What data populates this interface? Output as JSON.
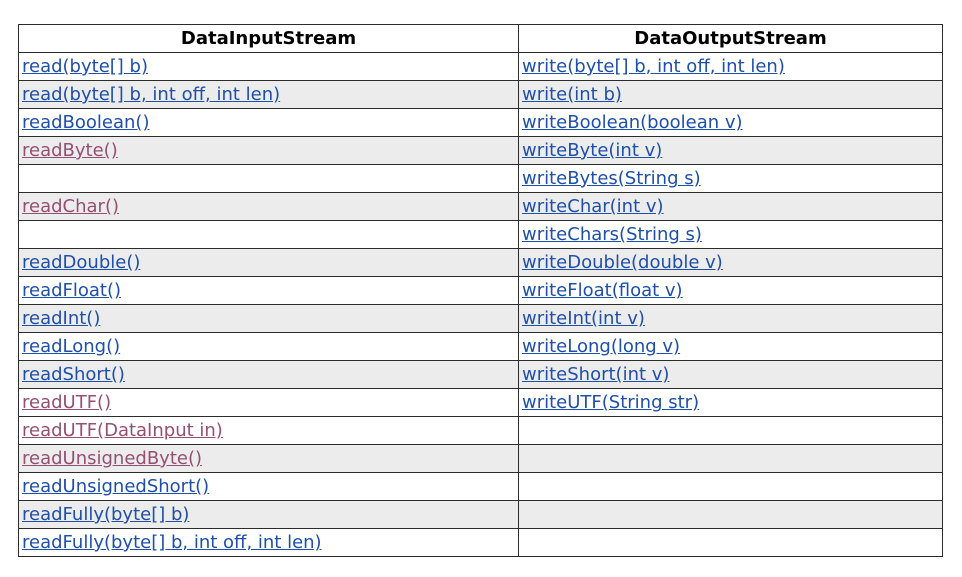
{
  "headers": {
    "left": "DataInputStream",
    "right": "DataOutputStream"
  },
  "colors": {
    "link": "#1f4fa8",
    "visited": "#954f72",
    "shade": "#ececec",
    "border": "#2b2b2b"
  },
  "rows": [
    {
      "input": "read(byte[] b)",
      "input_visited": false,
      "output": "write(byte[] b, int off, int len)",
      "output_visited": false,
      "shaded": false
    },
    {
      "input": "read(byte[] b, int off, int len)",
      "input_visited": false,
      "output": "write(int b)",
      "output_visited": false,
      "shaded": true
    },
    {
      "input": "readBoolean()",
      "input_visited": false,
      "output": "writeBoolean(boolean v)",
      "output_visited": false,
      "shaded": false
    },
    {
      "input": "readByte()",
      "input_visited": true,
      "output": "writeByte(int v)",
      "output_visited": false,
      "shaded": true
    },
    {
      "input": "",
      "input_visited": false,
      "output": "writeBytes(String s)",
      "output_visited": false,
      "shaded": false
    },
    {
      "input": "readChar()",
      "input_visited": true,
      "output": "writeChar(int v)",
      "output_visited": false,
      "shaded": true
    },
    {
      "input": "",
      "input_visited": false,
      "output": "writeChars(String s)",
      "output_visited": false,
      "shaded": false
    },
    {
      "input": "readDouble()",
      "input_visited": false,
      "output": "writeDouble(double v)",
      "output_visited": false,
      "shaded": true
    },
    {
      "input": "readFloat()",
      "input_visited": false,
      "output": "writeFloat(float v)",
      "output_visited": false,
      "shaded": false
    },
    {
      "input": "readInt()",
      "input_visited": false,
      "output": "writeInt(int v)",
      "output_visited": false,
      "shaded": true
    },
    {
      "input": "readLong()",
      "input_visited": false,
      "output": "writeLong(long v)",
      "output_visited": false,
      "shaded": false
    },
    {
      "input": "readShort()",
      "input_visited": false,
      "output": "writeShort(int v)",
      "output_visited": false,
      "shaded": true
    },
    {
      "input": "readUTF()",
      "input_visited": true,
      "output": "writeUTF(String str)",
      "output_visited": false,
      "shaded": false
    },
    {
      "input": "readUTF(DataInput in)",
      "input_visited": true,
      "output": "",
      "output_visited": false,
      "shaded": false
    },
    {
      "input": "readUnsignedByte()",
      "input_visited": true,
      "output": "",
      "output_visited": false,
      "shaded": true
    },
    {
      "input": "readUnsignedShort()",
      "input_visited": false,
      "output": "",
      "output_visited": false,
      "shaded": false
    },
    {
      "input": "readFully(byte[] b)",
      "input_visited": false,
      "output": "",
      "output_visited": false,
      "shaded": true
    },
    {
      "input": "readFully(byte[] b, int off, int len)",
      "input_visited": false,
      "output": "",
      "output_visited": false,
      "shaded": false
    }
  ]
}
